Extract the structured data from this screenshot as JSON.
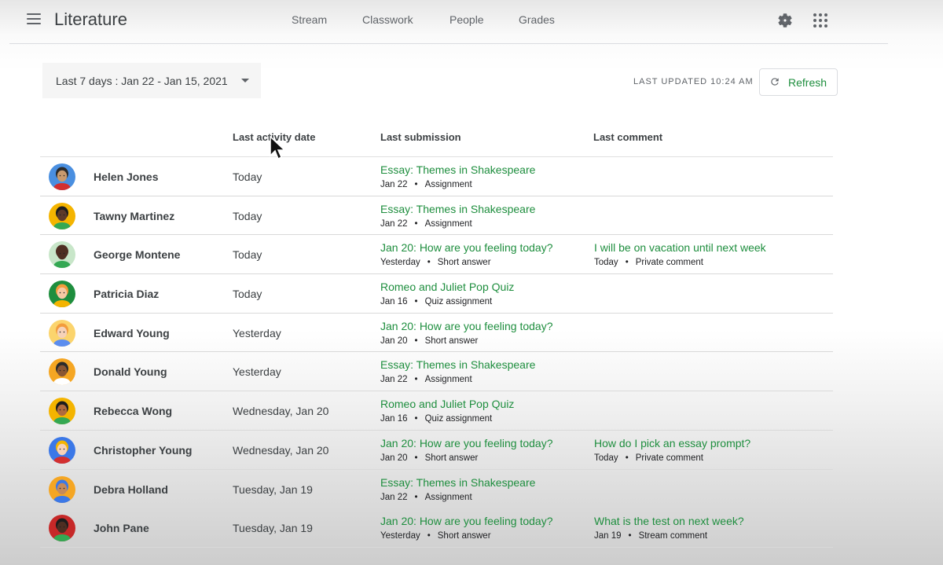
{
  "app": {
    "title": "Literature",
    "nav_tabs": [
      "Stream",
      "Classwork",
      "People",
      "Grades"
    ],
    "icons": {
      "menu": "hamburger-menu-icon",
      "settings": "gear-icon",
      "apps": "apps-grid-icon",
      "refresh": "refresh-icon",
      "dropdown": "caret-down-icon"
    }
  },
  "filter": {
    "date_range_label": "Last 7 days :  Jan 22 - Jan 15, 2021"
  },
  "status": {
    "last_updated": "LAST UPDATED 10:24 AM",
    "refresh_label": "Refresh"
  },
  "colors": {
    "accent_green": "#1e8e3e",
    "text_primary": "#3c4043"
  },
  "table": {
    "columns": [
      "",
      "Last activity date",
      "Last submission",
      "Last comment"
    ],
    "rows": [
      {
        "name": "Helen Jones",
        "last_activity": "Today",
        "submission": {
          "title": "Essay: Themes in Shakespeare",
          "date": "Jan 22",
          "type": "Assignment"
        },
        "comment": null
      },
      {
        "name": "Tawny Martinez",
        "last_activity": "Today",
        "submission": {
          "title": "Essay: Themes in Shakespeare",
          "date": "Jan 22",
          "type": "Assignment"
        },
        "comment": null
      },
      {
        "name": "George Montene",
        "last_activity": "Today",
        "submission": {
          "title": "Jan 20: How are you feeling today?",
          "date": "Yesterday",
          "type": "Short answer"
        },
        "comment": {
          "text": "I will be on vacation until next week",
          "date": "Today",
          "type": "Private comment"
        }
      },
      {
        "name": "Patricia Diaz",
        "last_activity": "Today",
        "submission": {
          "title": "Romeo and Juliet Pop Quiz",
          "date": "Jan 16",
          "type": "Quiz assignment"
        },
        "comment": null
      },
      {
        "name": "Edward Young",
        "last_activity": "Yesterday",
        "submission": {
          "title": "Jan 20: How are you feeling today?",
          "date": "Jan 20",
          "type": "Short answer"
        },
        "comment": null
      },
      {
        "name": "Donald Young",
        "last_activity": "Yesterday",
        "submission": {
          "title": "Essay: Themes in Shakespeare",
          "date": "Jan 22",
          "type": "Assignment"
        },
        "comment": null
      },
      {
        "name": "Rebecca Wong",
        "last_activity": "Wednesday, Jan 20",
        "submission": {
          "title": "Romeo and Juliet Pop Quiz",
          "date": "Jan 16",
          "type": "Quiz assignment"
        },
        "comment": null
      },
      {
        "name": "Christopher Young",
        "last_activity": "Wednesday, Jan 20",
        "submission": {
          "title": "Jan 20: How are you feeling today?",
          "date": "Jan 20",
          "type": "Short answer"
        },
        "comment": {
          "text": "How do I pick an essay prompt?",
          "date": "Today",
          "type": "Private comment"
        }
      },
      {
        "name": "Debra Holland",
        "last_activity": "Tuesday, Jan 19",
        "submission": {
          "title": "Essay: Themes in Shakespeare",
          "date": "Jan 22",
          "type": "Assignment"
        },
        "comment": null
      },
      {
        "name": "John Pane",
        "last_activity": "Tuesday, Jan 19",
        "submission": {
          "title": "Jan 20: How are you feeling today?",
          "date": "Yesterday",
          "type": "Short answer"
        },
        "comment": {
          "text": "What is the test on next week?",
          "date": "Jan 19",
          "type": "Stream comment"
        }
      }
    ],
    "avatar_colors": [
      {
        "bg": "#4a8fe0",
        "skin": "#c89a6e",
        "hair": "#2b2b2b",
        "shirt": "#d32f2f"
      },
      {
        "bg": "#f4b400",
        "skin": "#5d3a2a",
        "hair": "#1d1d1d",
        "shirt": "#34a853"
      },
      {
        "bg": "#c8e6c9",
        "skin": "#4e2e22",
        "hair": "#4e2e22",
        "shirt": "#34a853"
      },
      {
        "bg": "#1e8e3e",
        "skin": "#f6c9a4",
        "hair": "#f39c3c",
        "shirt": "#f4b400"
      },
      {
        "bg": "#fbd46d",
        "skin": "#f6d2b8",
        "hair": "#f39c3c",
        "shirt": "#5b8def"
      },
      {
        "bg": "#f5a623",
        "skin": "#8a5633",
        "hair": "#2b2b2b",
        "shirt": "#ffffff"
      },
      {
        "bg": "#f4b400",
        "skin": "#b06a3e",
        "hair": "#1d1d1d",
        "shirt": "#34a853"
      },
      {
        "bg": "#3b78e7",
        "skin": "#f6d2b8",
        "hair": "#f4b400",
        "shirt": "#d32f2f"
      },
      {
        "bg": "#f5a623",
        "skin": "#c68a5a",
        "hair": "#3b78e7",
        "shirt": "#3b78e7"
      },
      {
        "bg": "#c62828",
        "skin": "#4e2e22",
        "hair": "#1d1d1d",
        "shirt": "#34a853"
      }
    ]
  }
}
